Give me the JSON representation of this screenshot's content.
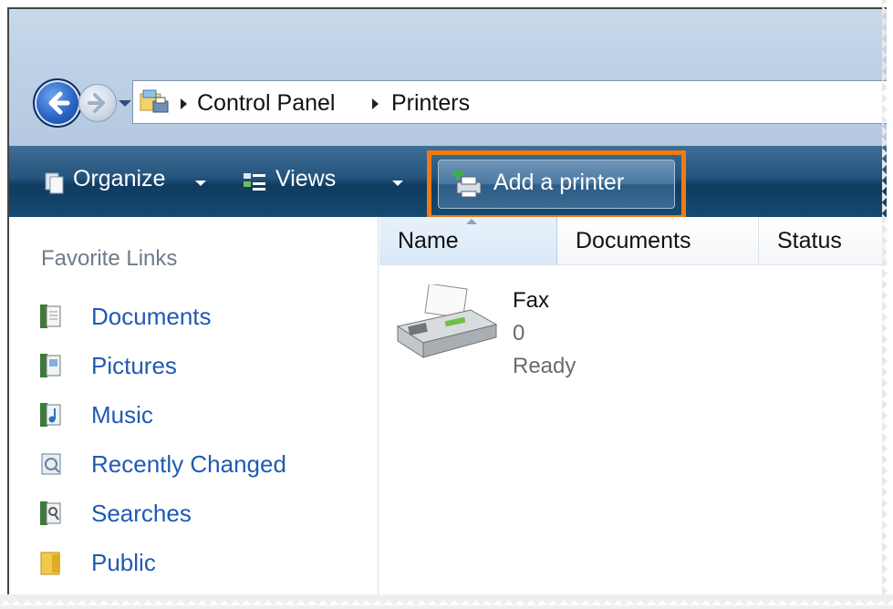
{
  "address": {
    "crumbs": [
      "Control Panel",
      "Printers"
    ]
  },
  "toolbar": {
    "organize_label": "Organize",
    "views_label": "Views",
    "add_printer_label": "Add a printer",
    "highlight_color": "#f07a12"
  },
  "sidebar": {
    "title": "Favorite Links",
    "items": [
      {
        "label": "Documents",
        "icon": "documents-icon"
      },
      {
        "label": "Pictures",
        "icon": "pictures-icon"
      },
      {
        "label": "Music",
        "icon": "music-icon"
      },
      {
        "label": "Recently Changed",
        "icon": "recently-changed-icon"
      },
      {
        "label": "Searches",
        "icon": "searches-icon"
      },
      {
        "label": "Public",
        "icon": "public-folder-icon"
      }
    ]
  },
  "columns": {
    "name": "Name",
    "documents": "Documents",
    "status": "Status"
  },
  "printers": [
    {
      "name": "Fax",
      "documents": "0",
      "status": "Ready",
      "icon": "fax-icon"
    }
  ]
}
